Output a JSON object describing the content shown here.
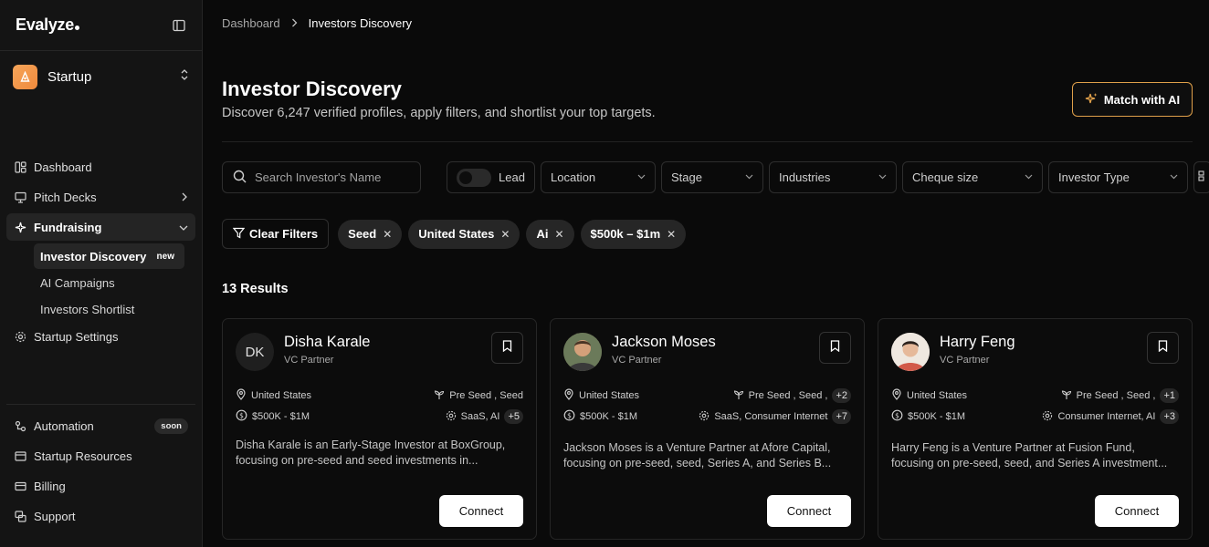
{
  "app": {
    "logo": "Evalyze"
  },
  "workspace": {
    "name": "Startup"
  },
  "nav": {
    "dashboard": "Dashboard",
    "pitch_decks": "Pitch Decks",
    "fundraising": "Fundraising",
    "sub": {
      "investor_discovery": "Investor Discovery",
      "investor_discovery_badge": "new",
      "ai_campaigns": "AI Campaigns",
      "investors_shortlist": "Investors Shortlist"
    },
    "startup_settings": "Startup Settings",
    "automation": "Automation",
    "automation_badge": "soon",
    "startup_resources": "Startup Resources",
    "billing": "Billing",
    "support": "Support"
  },
  "breadcrumb": {
    "root": "Dashboard",
    "current": "Investors Discovery"
  },
  "page": {
    "title": "Investor Discovery",
    "subtitle": "Discover 6,247 verified profiles, apply filters, and shortlist your top targets.",
    "match_button": "Match with AI"
  },
  "filters": {
    "search_placeholder": "Search Investor's Name",
    "lead": "Lead",
    "location": "Location",
    "stage": "Stage",
    "industries": "Industries",
    "cheque_size": "Cheque size",
    "investor_type": "Investor Type"
  },
  "active_filters": {
    "clear": "Clear Filters",
    "chips": [
      "Seed",
      "United States",
      "Ai",
      "$500k – $1m"
    ]
  },
  "results": {
    "label": "13 Results"
  },
  "cards": [
    {
      "initials": "DK",
      "name": "Disha Karale",
      "role": "VC Partner",
      "location": "United States",
      "stages": "Pre Seed , Seed",
      "stages_more": "",
      "cheque": "$500K - $1M",
      "industries": "SaaS, AI",
      "industries_more": "+5",
      "description": "Disha Karale is an Early-Stage Investor at BoxGroup, focusing on pre-seed and seed investments in...",
      "connect": "Connect"
    },
    {
      "initials": "",
      "name": "Jackson Moses",
      "role": "VC Partner",
      "location": "United States",
      "stages": "Pre Seed , Seed ,",
      "stages_more": "+2",
      "cheque": "$500K - $1M",
      "industries": "SaaS, Consumer Internet",
      "industries_more": "+7",
      "description": "Jackson Moses is a Venture Partner at Afore Capital, focusing on pre-seed, seed, Series A, and Series B...",
      "connect": "Connect"
    },
    {
      "initials": "",
      "name": "Harry Feng",
      "role": "VC Partner",
      "location": "United States",
      "stages": "Pre Seed , Seed ,",
      "stages_more": "+1",
      "cheque": "$500K - $1M",
      "industries": "Consumer Internet, AI",
      "industries_more": "+3",
      "description": "Harry Feng is a Venture Partner at Fusion Fund, focusing on pre-seed, seed, and Series A investment...",
      "connect": "Connect"
    }
  ],
  "colors": {
    "accent": "#e0a04a",
    "workspace_avatar": "#f39a4a",
    "background": "#0a0a0a",
    "sidebar": "#141414"
  }
}
